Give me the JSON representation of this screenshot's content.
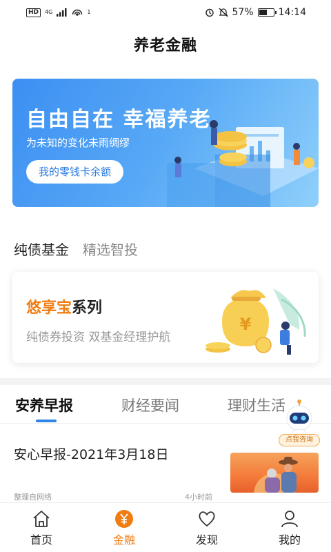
{
  "status_bar": {
    "network": "HD",
    "net_type": "4G",
    "wifi_badge": "1",
    "battery": "57%",
    "battery_level": 0.57,
    "time": "14:14"
  },
  "header": {
    "title": "养老金融"
  },
  "banner": {
    "headline": "自由自在 幸福养老",
    "subtitle": "为未知的变化未雨绸缪",
    "button_label": "我的零钱卡余额"
  },
  "fund_tabs": [
    {
      "label": "纯债基金",
      "active": true
    },
    {
      "label": "精选智投",
      "active": false
    }
  ],
  "product_card": {
    "title_highlight": "悠享宝",
    "title_rest": "系列",
    "subtitle": "纯债券投资 双基金经理护航"
  },
  "news_tabs": [
    {
      "label": "安养早报",
      "active": true
    },
    {
      "label": "财经要闻",
      "active": false
    },
    {
      "label": "理财生活",
      "active": false
    }
  ],
  "article": {
    "title": "安心早报-2021年3月18日",
    "source": "整理自网络",
    "time": "4小时前"
  },
  "assistant": {
    "label": "点我咨询"
  },
  "bottom_nav": [
    {
      "label": "首页",
      "icon": "home-icon",
      "active": false
    },
    {
      "label": "金融",
      "icon": "yuan-icon",
      "active": true
    },
    {
      "label": "发现",
      "icon": "heart-icon",
      "active": false
    },
    {
      "label": "我的",
      "icon": "user-icon",
      "active": false
    }
  ],
  "colors": {
    "accent_orange": "#f07d14",
    "accent_blue": "#2f86e8",
    "banner_blue": "#3c8ff2"
  }
}
